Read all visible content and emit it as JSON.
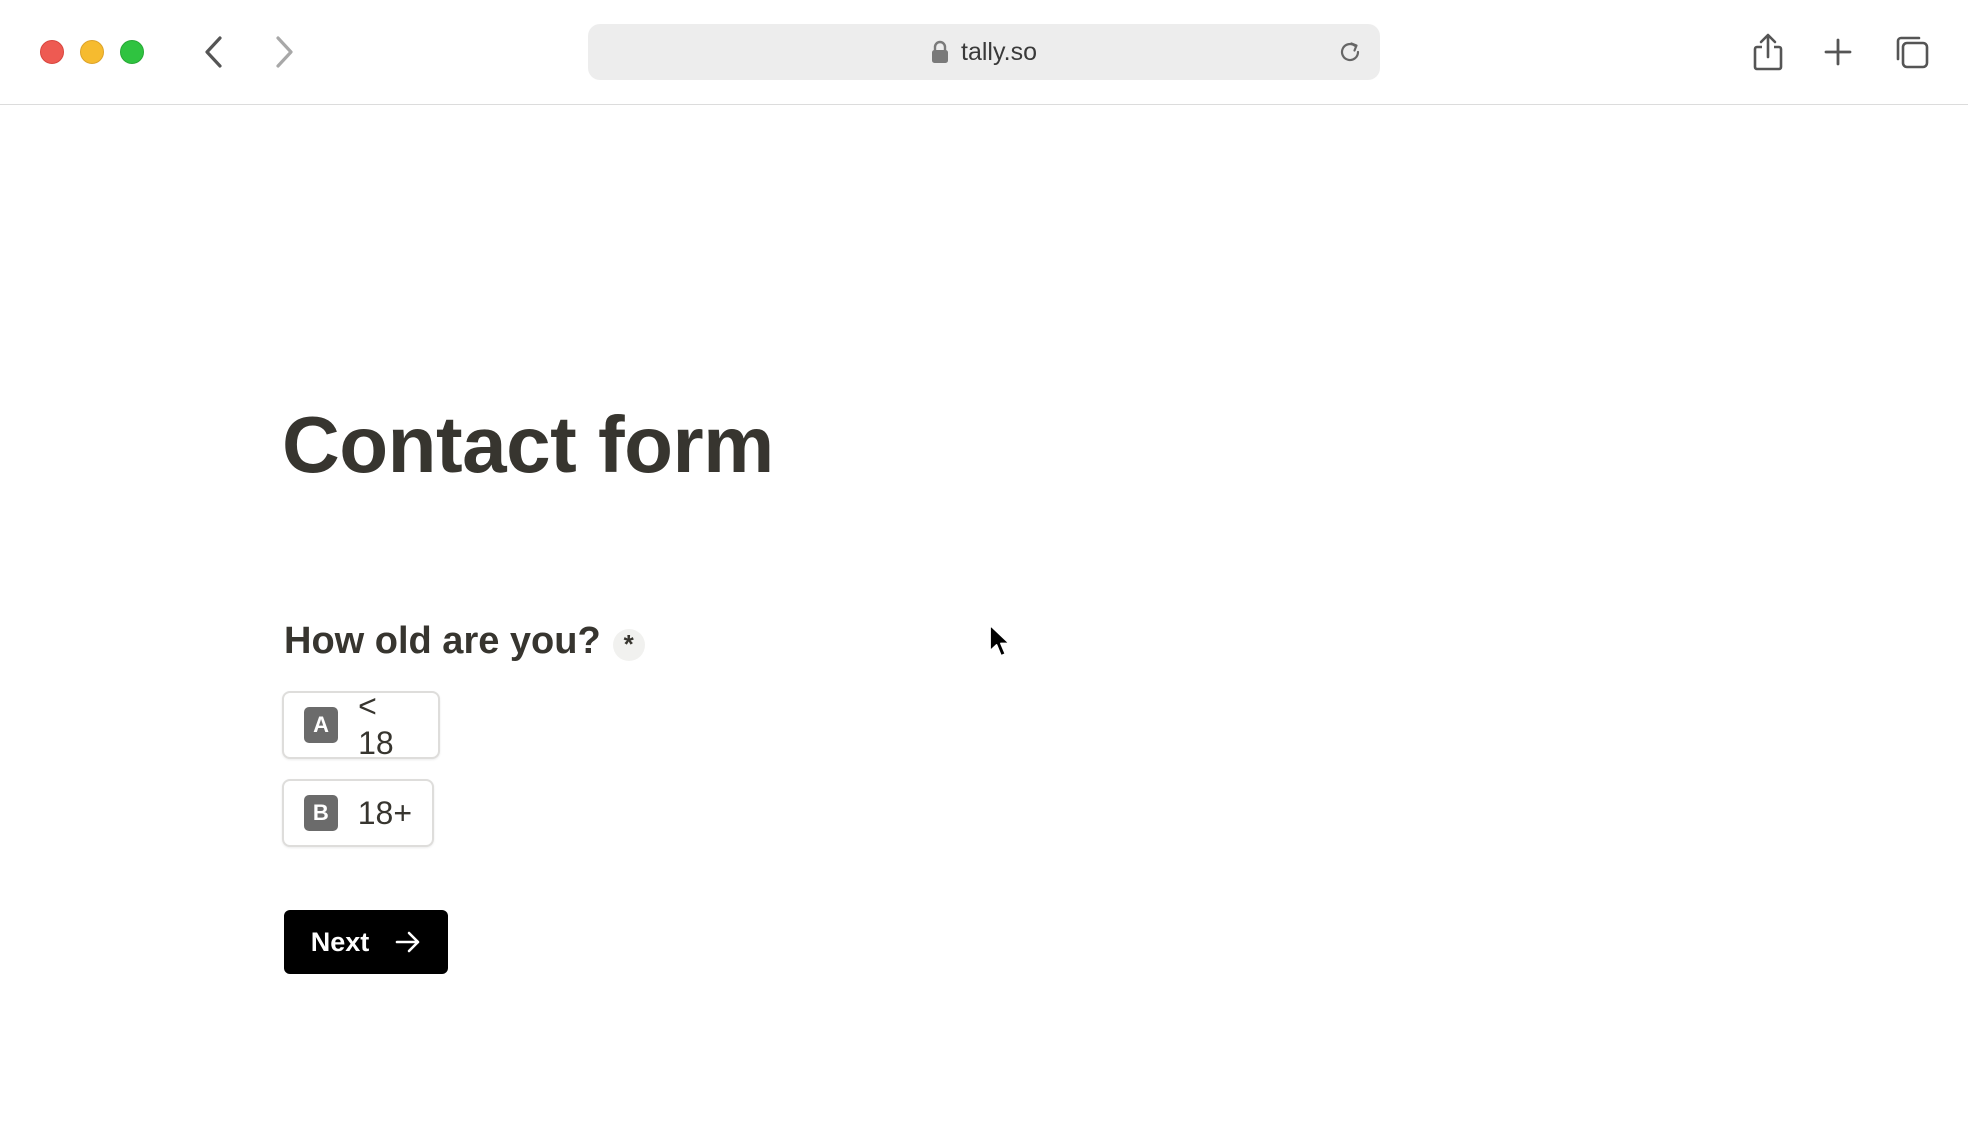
{
  "browser": {
    "url": "tally.so",
    "icons": {
      "back": "chevron-left-icon",
      "forward": "chevron-right-icon",
      "lock": "lock-icon",
      "reload": "reload-icon",
      "share": "share-icon",
      "new_tab": "plus-icon",
      "tabs_overview": "tabs-icon"
    },
    "colors": {
      "close": "#ee5a52",
      "minimize": "#f6bb2f",
      "maximize": "#2fc340"
    }
  },
  "form": {
    "title": "Contact form",
    "question": {
      "text": "How old are you?",
      "required_marker": "*",
      "options": [
        {
          "key": "A",
          "label": "< 18"
        },
        {
          "key": "B",
          "label": "18+"
        }
      ]
    },
    "next_button": {
      "label": "Next",
      "icon": "arrow-right-icon"
    },
    "colors": {
      "text": "#37352f",
      "button_bg": "#000000",
      "key_badge": "#6b6b6b"
    }
  }
}
